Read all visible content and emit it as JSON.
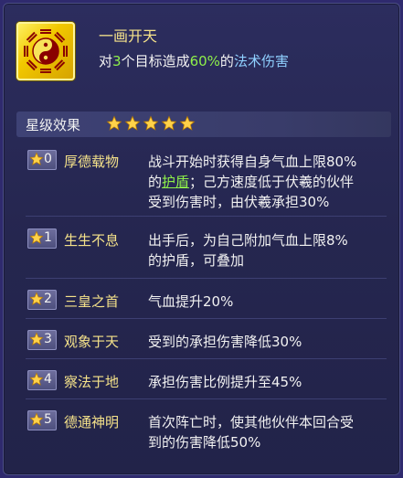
{
  "skill": {
    "icon": "bagua-yin-yang-icon",
    "title": "一画开天",
    "desc": {
      "part1": "对",
      "count": "3",
      "part2": "个目标造成",
      "percent": "60%",
      "part3": "的",
      "type": "法术伤害"
    }
  },
  "star_effects": {
    "title": "星级效果",
    "stars_filled": 5,
    "rows": [
      {
        "level": "0",
        "name": "厚德载物",
        "lines": [
          "战斗开始时获得自身气血上限80%",
          "的",
          "护盾",
          "；己方速度低于伏羲的伙伴",
          "受到伤害时，由伏羲承担30%"
        ]
      },
      {
        "level": "1",
        "name": "生生不息",
        "lines": [
          "出手后，为自己附加气血上限8%",
          "的护盾，可叠加"
        ]
      },
      {
        "level": "2",
        "name": "三皇之首",
        "lines": [
          "气血提升20%"
        ]
      },
      {
        "level": "3",
        "name": "观象于天",
        "lines": [
          "受到的承担伤害降低30%"
        ]
      },
      {
        "level": "4",
        "name": "察法于地",
        "lines": [
          "承担伤害比例提升至45%"
        ]
      },
      {
        "level": "5",
        "name": "德通神明",
        "lines": [
          "首次阵亡时，使其他伙伴本回合受",
          "到的伤害降低50%"
        ]
      }
    ]
  },
  "colors": {
    "title": "#f5e28a",
    "green": "#8ef04a",
    "blue": "#8fd0ff",
    "star": "#ffd24a"
  }
}
